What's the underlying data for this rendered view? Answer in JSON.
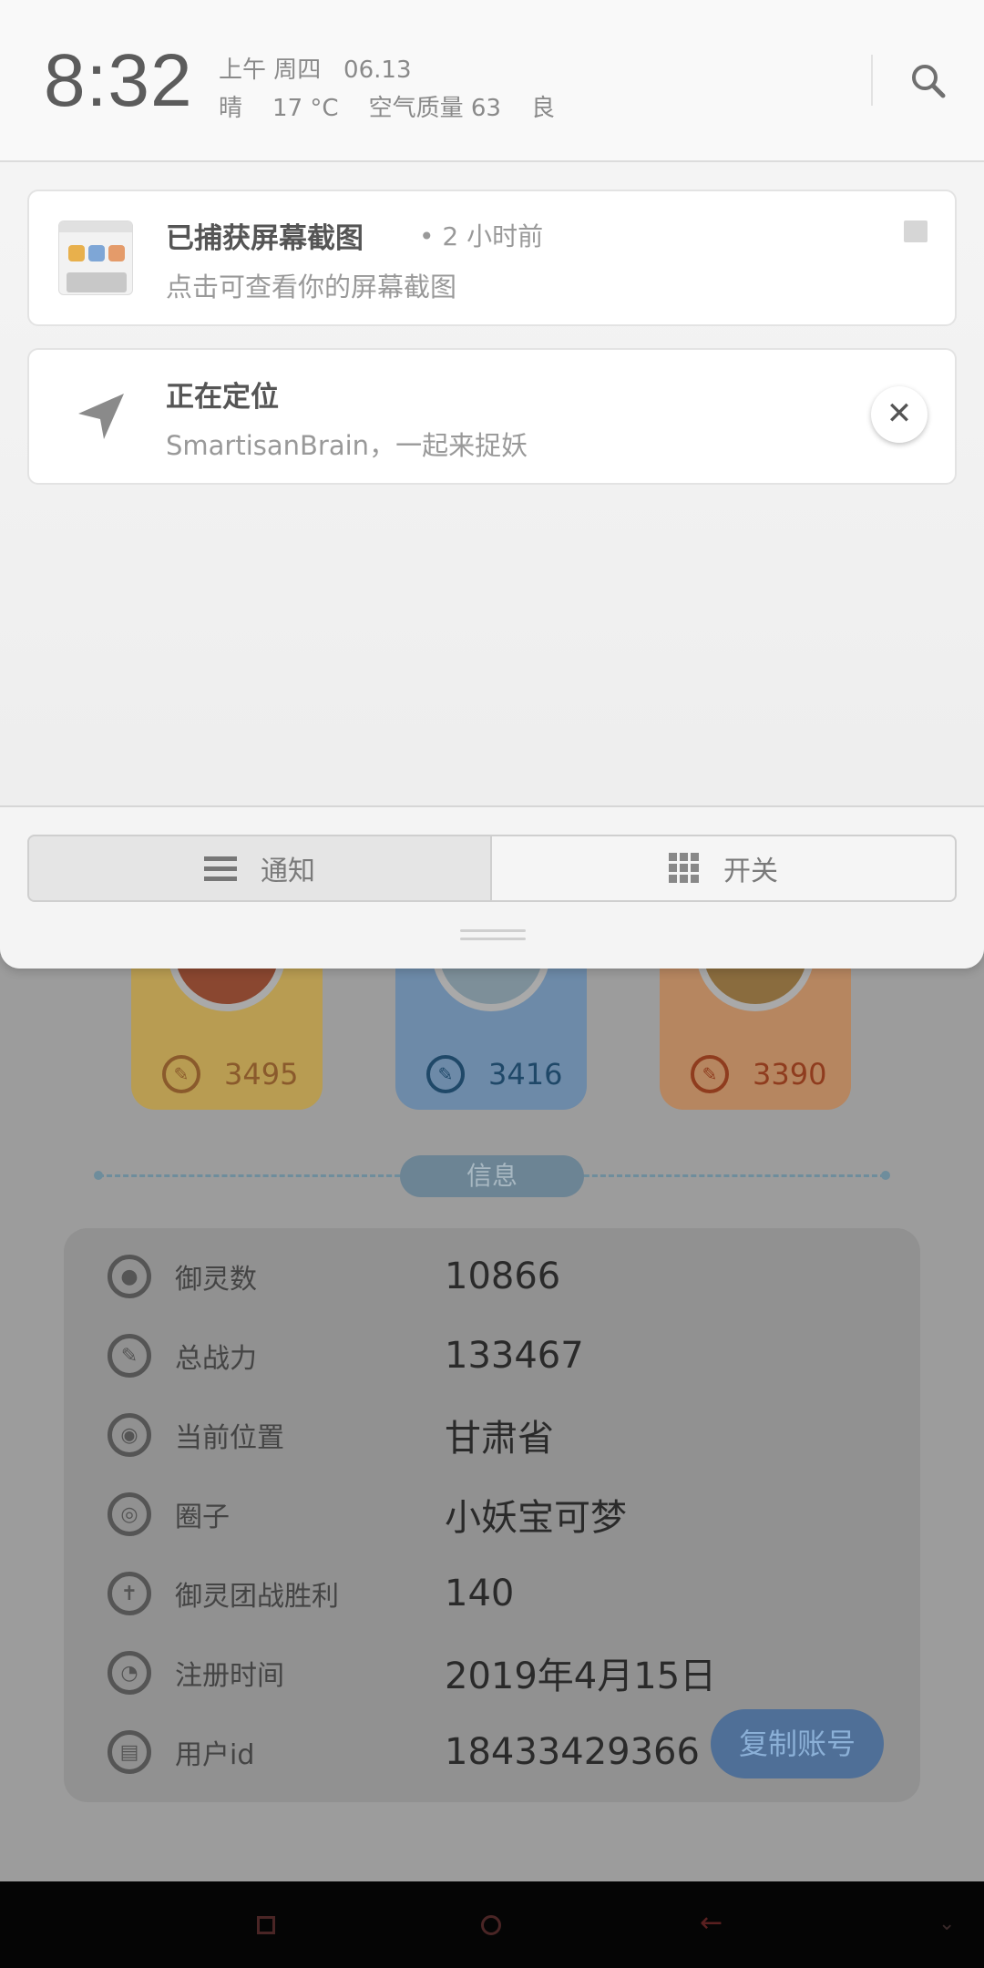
{
  "status_bar": {
    "time": "8:32",
    "line1": "上午 周四   06.13",
    "line2": "晴    17 °C    空气质量 63    良"
  },
  "notifications": [
    {
      "title": "已捕获屏幕截图",
      "time": "• 2 小时前",
      "subtitle": "点击可查看你的屏幕截图"
    },
    {
      "title": "正在定位",
      "subtitle": "SmartisanBrain，一起来捉妖"
    }
  ],
  "tabs": {
    "notify": "通知",
    "switches": "开关"
  },
  "app": {
    "heroes": [
      {
        "score": "3495"
      },
      {
        "score": "3416"
      },
      {
        "score": "3390"
      }
    ],
    "info_tag": "信息",
    "info": [
      {
        "label": "御灵数",
        "value": "10866"
      },
      {
        "label": "总战力",
        "value": "133467"
      },
      {
        "label": "当前位置",
        "value": "甘肃省"
      },
      {
        "label": "圈子",
        "value": "小妖宝可梦"
      },
      {
        "label": "御灵团战胜利",
        "value": "140"
      },
      {
        "label": "注册时间",
        "value": "2019年4月15日"
      },
      {
        "label": "用户id",
        "value": "18433429366"
      }
    ],
    "copy_button": "复制账号"
  }
}
